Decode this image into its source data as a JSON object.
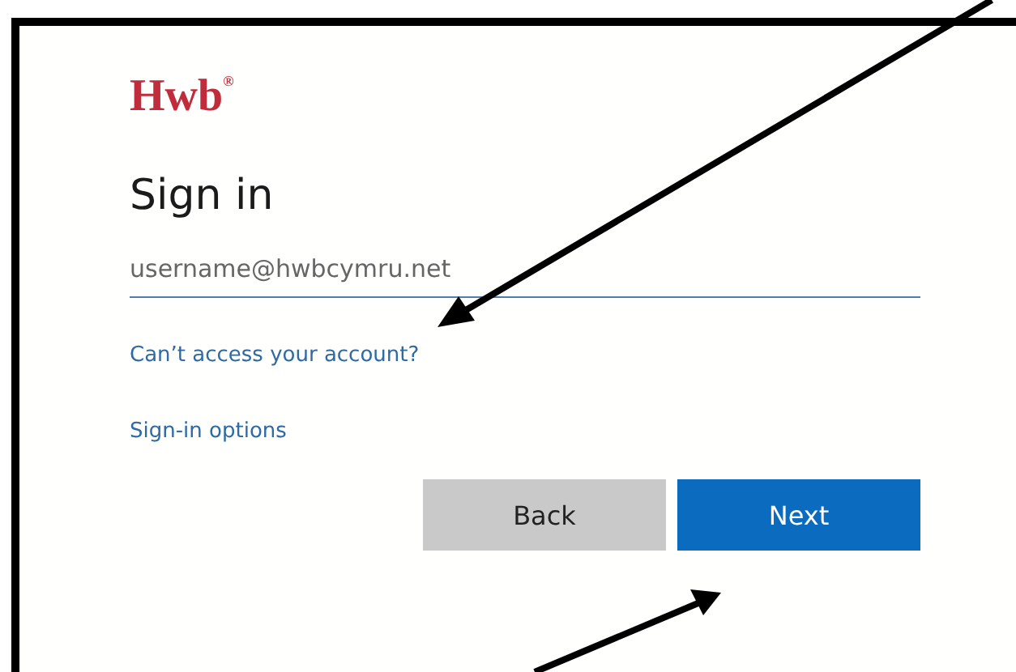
{
  "logo": {
    "text": "Hwb",
    "mark": "®"
  },
  "title": "Sign in",
  "username_field": {
    "placeholder": "username@hwbcymru.net"
  },
  "links": [
    "Can’t access your account?",
    "Sign-in options"
  ],
  "buttons": [
    {
      "label": "Back",
      "kind": "secondary"
    },
    {
      "label": "Next",
      "kind": "primary"
    }
  ]
}
